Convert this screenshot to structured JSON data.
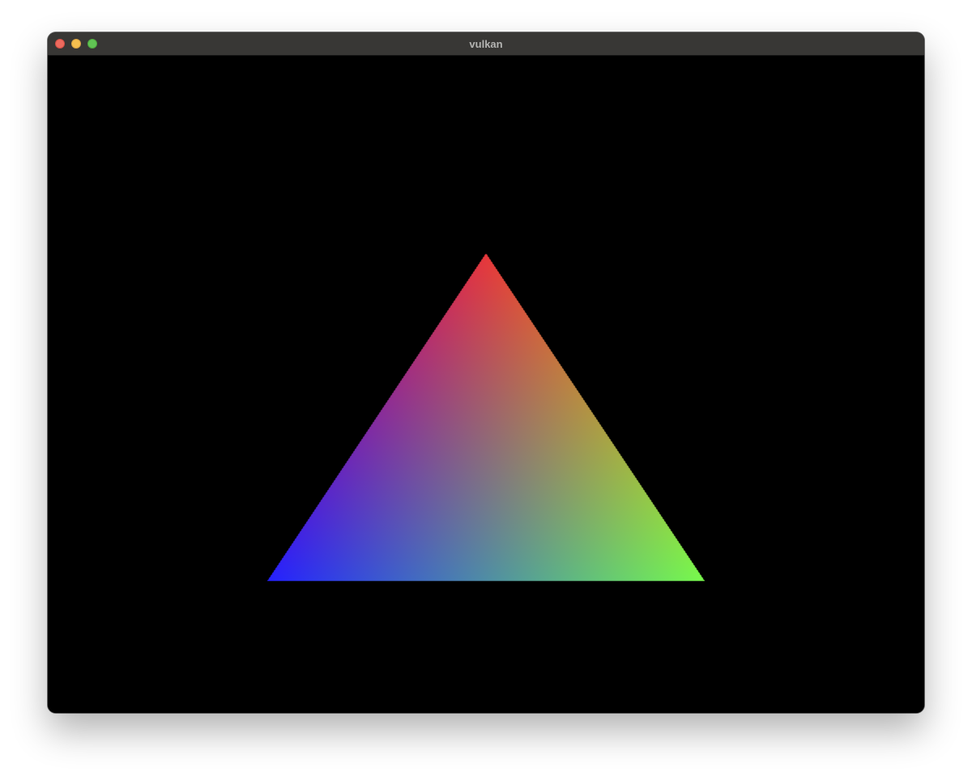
{
  "window": {
    "title": "vulkan",
    "buttons": {
      "close": {
        "color": "#ed6a5e",
        "border": "#d24f45"
      },
      "minimize": {
        "color": "#f5bf4f",
        "border": "#d6a243"
      },
      "zoom": {
        "color": "#61c554",
        "border": "#4fa73f"
      }
    }
  },
  "scene": {
    "background": "#000000",
    "vertices": [
      {
        "name": "top",
        "color": "#e8373a"
      },
      {
        "name": "bottom-right",
        "color": "#78fa4c"
      },
      {
        "name": "bottom-left",
        "color": "#2521ff"
      }
    ]
  }
}
